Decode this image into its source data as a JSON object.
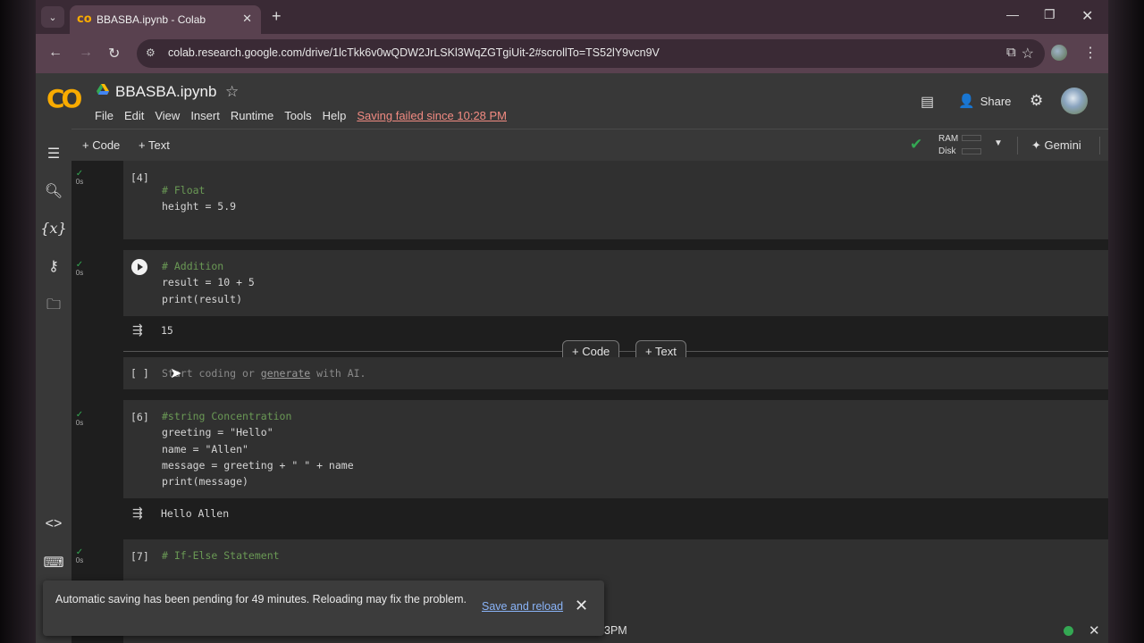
{
  "browser": {
    "tab_title": "BBASBA.ipynb - Colab",
    "tab_favicon": "co",
    "new_tab": "+",
    "url": "colab.research.google.com/drive/1lcTkk6v0wQDW2JrLSKl3WqZGTgiUit-2#scrollTo=TS52lY9vcn9V"
  },
  "colab": {
    "logo": "CO",
    "notebook_title": "BBASBA.ipynb",
    "menu": [
      "File",
      "Edit",
      "View",
      "Insert",
      "Runtime",
      "Tools",
      "Help"
    ],
    "save_status": "Saving failed since 10:28 PM",
    "share_label": "Share"
  },
  "toolbar": {
    "add_code": "+ Code",
    "add_text": "+ Text",
    "ram_label": "RAM",
    "disk_label": "Disk",
    "gemini_label": "Gemini"
  },
  "cells": {
    "float_cell": {
      "count": "[4]",
      "status": "0s",
      "lines": [
        "# Float",
        "height = 5.9"
      ]
    },
    "addition_cell": {
      "status": "0s",
      "lines": [
        "# Addition",
        "result = 10 + 5",
        "print(result)"
      ],
      "output": "15"
    },
    "insert_bar": {
      "code": "+ Code",
      "text": "+ Text"
    },
    "empty_cell": {
      "count": "[ ]",
      "placeholder_pre": "Start coding or ",
      "placeholder_link": "generate",
      "placeholder_post": " with AI."
    },
    "string_cell": {
      "count": "[6]",
      "status": "0s",
      "lines": [
        "#string Concentration",
        "greeting = \"Hello\"",
        "name = \"Allen\"",
        "message = greeting + \" \" + name",
        "print(message)"
      ],
      "output": "Hello Allen"
    },
    "ifelse_cell": {
      "count": "[7]",
      "status": "0s",
      "lines": [
        "# If-Else Statement"
      ]
    }
  },
  "snackbar": {
    "message": "Automatic saving has been pending for 49 minutes. Reloading may fix the problem.",
    "action": "Save and reload"
  },
  "statusbar": {
    "time_fragment": "3PM"
  },
  "colors": {
    "accent": "#f9ab00",
    "error": "#f28b82",
    "success": "#34a853",
    "link": "#8ab4f8"
  }
}
